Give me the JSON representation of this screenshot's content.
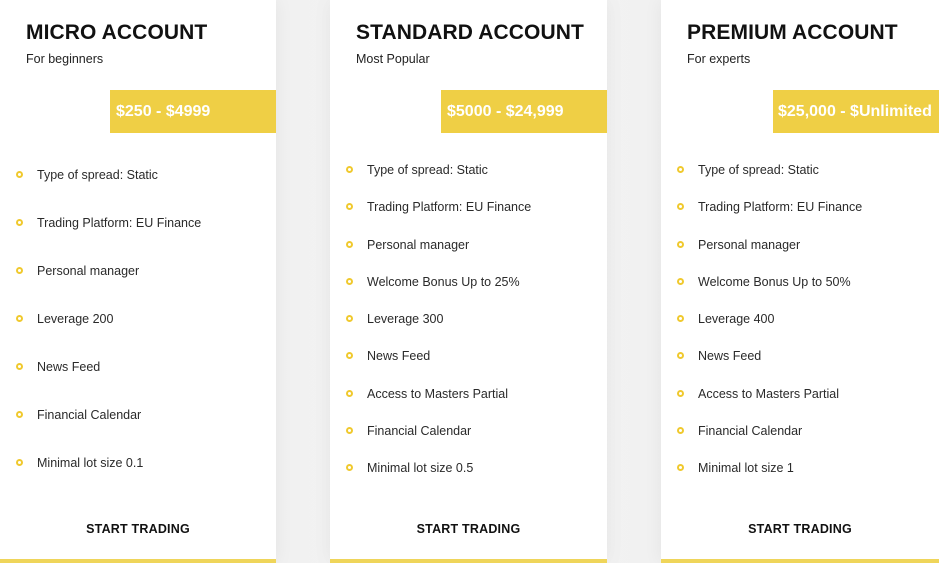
{
  "colors": {
    "accent": "#efcf45",
    "bullet": "#f0c92e",
    "text": "#111111",
    "background": "#efefef"
  },
  "plans": [
    {
      "title": "MICRO ACCOUNT",
      "subtitle": "For beginners",
      "price_range": "$250 - $4999",
      "features": [
        "Type of spread: Static",
        "Trading Platform: EU Finance",
        "Personal manager",
        "Leverage 200",
        "News Feed",
        "Financial Calendar",
        "Minimal lot size 0.1"
      ],
      "cta_label": "START TRADING"
    },
    {
      "title": "STANDARD ACCOUNT",
      "subtitle": "Most Popular",
      "price_range": "$5000 - $24,999",
      "features": [
        "Type of spread: Static",
        "Trading Platform: EU Finance",
        "Personal manager",
        "Welcome Bonus Up to 25%",
        "Leverage 300",
        "News Feed",
        "Access to Masters Partial",
        "Financial Calendar",
        "Minimal lot size 0.5"
      ],
      "cta_label": "START TRADING"
    },
    {
      "title": "PREMIUM ACCOUNT",
      "subtitle": "For experts",
      "price_range": "$25,000 - $Unlimited",
      "features": [
        "Type of spread: Static",
        "Trading Platform: EU Finance",
        "Personal manager",
        "Welcome Bonus Up to 50%",
        "Leverage 400",
        "News Feed",
        "Access to Masters Partial",
        "Financial Calendar",
        "Minimal lot size 1"
      ],
      "cta_label": "START TRADING"
    }
  ]
}
